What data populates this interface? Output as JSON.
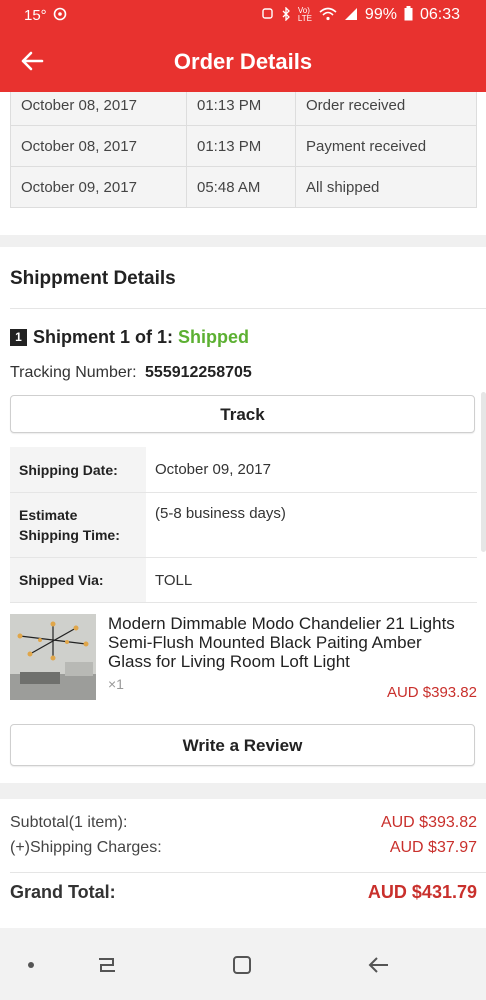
{
  "status_bar": {
    "temperature": "15°",
    "battery": "99%",
    "time": "06:33"
  },
  "header": {
    "title": "Order Details"
  },
  "order_history": [
    {
      "date": "October 08, 2017",
      "time": "01:13 PM",
      "status": "Order received"
    },
    {
      "date": "October 08, 2017",
      "time": "01:13 PM",
      "status": "Payment received"
    },
    {
      "date": "October 09, 2017",
      "time": "05:48 AM",
      "status": "All shipped"
    }
  ],
  "shipment": {
    "section_title": "Shippment Details",
    "badge": "1",
    "label": "Shipment 1 of 1:",
    "status": "Shipped",
    "tracking_label": "Tracking Number:",
    "tracking_number": "555912258705",
    "track_button": "Track",
    "details": [
      {
        "label": "Shipping Date:",
        "value": "October 09, 2017"
      },
      {
        "label": "Estimate Shipping Time:",
        "value": "(5-8 business days)"
      },
      {
        "label": "Shipped Via:",
        "value": "TOLL"
      }
    ]
  },
  "product": {
    "name": "Modern Dimmable Modo Chandelier 21 Lights Semi-Flush Mounted Black Paiting Amber Glass for Living Room Loft Light",
    "quantity": "×1",
    "price": "AUD $393.82"
  },
  "review_button": "Write a Review",
  "summary": {
    "subtotal_label": "Subtotal(1 item):",
    "subtotal_value": "AUD $393.82",
    "shipping_label": "(+)Shipping Charges:",
    "shipping_value": "AUD $37.97",
    "grand_label": "Grand Total:",
    "grand_value": "AUD $431.79"
  },
  "colors": {
    "accent": "#e8322f",
    "shipped": "#5cb032",
    "price": "#c9302c"
  }
}
